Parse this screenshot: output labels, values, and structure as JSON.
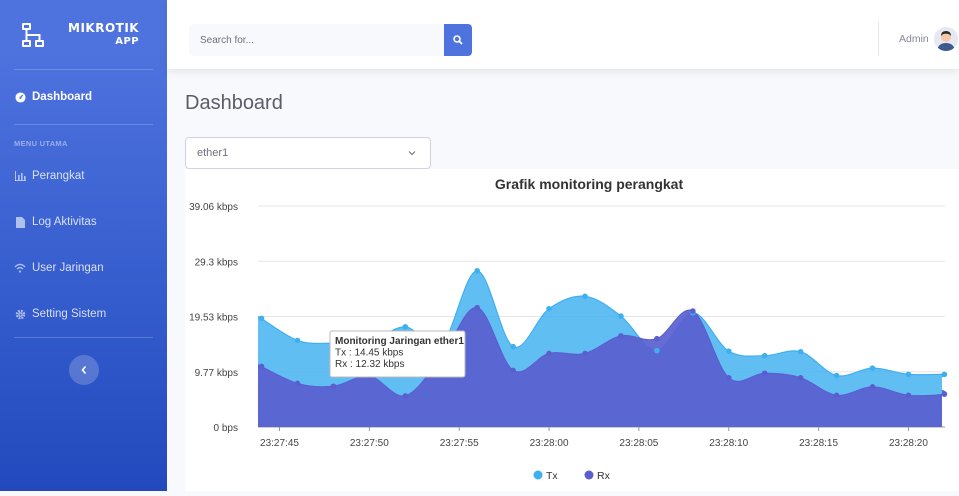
{
  "brand": {
    "line1": "MIKROTIK",
    "line2": "APP"
  },
  "sidebar": {
    "active": {
      "label": "Dashboard"
    },
    "heading": "MENU UTAMA",
    "items": [
      {
        "label": "Perangkat",
        "icon": "chart-icon"
      },
      {
        "label": "Log Aktivitas",
        "icon": "file-icon"
      },
      {
        "label": "User Jaringan",
        "icon": "wifi-icon"
      },
      {
        "label": "Setting Sistem",
        "icon": "gear-icon"
      }
    ]
  },
  "topbar": {
    "search_placeholder": "Search for...",
    "user_name": "Admin"
  },
  "page": {
    "title": "Dashboard",
    "interface": "ether1"
  },
  "colors": {
    "primary": "#4e73df",
    "tx": "#3eb0f0",
    "rx": "#5a5fd0"
  },
  "chart_data": {
    "type": "area",
    "title": "Grafik monitoring perangkat",
    "y_ticks": [
      "0 bps",
      "9.77 kbps",
      "19.53 kbps",
      "29.3 kbps",
      "39.06 kbps"
    ],
    "ylim": [
      0,
      39.06
    ],
    "x_ticks": [
      "23:27:45",
      "23:27:50",
      "23:27:55",
      "23:28:00",
      "23:28:05",
      "23:28:10",
      "23:28:15",
      "23:28:20"
    ],
    "x_seconds": [
      -1,
      1,
      3,
      5,
      7,
      9,
      11,
      13,
      15,
      17,
      19,
      21,
      23,
      25,
      27,
      29,
      31,
      33,
      35,
      37,
      39
    ],
    "series": [
      {
        "name": "Tx",
        "values": [
          19.2,
          15.3,
          14.8,
          15.0,
          17.7,
          14.45,
          27.6,
          14.2,
          20.9,
          23.1,
          19.6,
          13.5,
          20.2,
          13.4,
          12.6,
          13.3,
          9.1,
          10.4,
          9.3,
          9.3,
          8.9
        ]
      },
      {
        "name": "Rx",
        "values": [
          10.7,
          7.7,
          7.2,
          9.0,
          5.5,
          12.32,
          21.1,
          10.0,
          13.0,
          13.0,
          16.1,
          15.6,
          20.5,
          8.7,
          9.5,
          8.7,
          5.6,
          7.1,
          5.6,
          5.8,
          6.5
        ]
      }
    ],
    "tooltip": {
      "title": "Monitoring Jaringan ether1",
      "tx": "Tx : 14.45 kbps",
      "rx": "Rx : 12.32 kbps"
    },
    "legend": [
      "Tx",
      "Rx"
    ],
    "legend_position": "bottom"
  }
}
